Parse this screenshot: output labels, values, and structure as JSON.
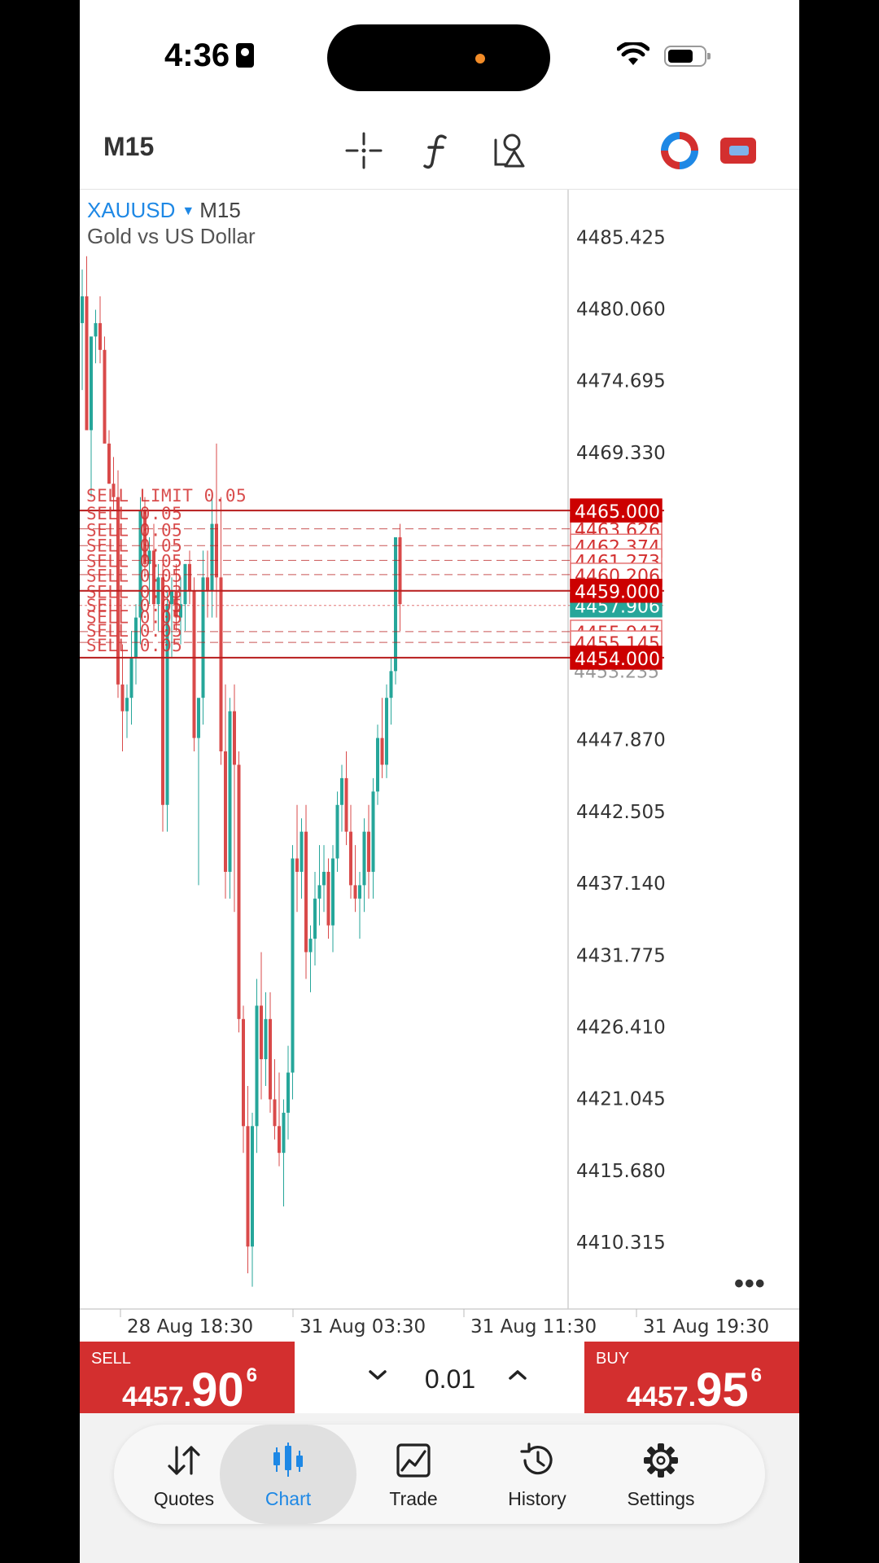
{
  "status_bar": {
    "time": "4:36"
  },
  "toolbar": {
    "timeframe": "M15",
    "icons": [
      "crosshair-icon",
      "function-icon",
      "objects-icon",
      "accounts-icon",
      "window-switch-icon"
    ]
  },
  "chart": {
    "symbol": "XAUUSD",
    "timeframe": "M15",
    "description": "Gold vs US Dollar",
    "price_axis_labels": [
      "4485.425",
      "4480.060",
      "4474.695",
      "4469.330",
      "4447.870",
      "4442.505",
      "4437.140",
      "4431.775",
      "4426.410",
      "4421.045",
      "4415.680",
      "4410.315"
    ],
    "time_axis_labels": [
      "28 Aug 18:30",
      "31 Aug 03:30",
      "31 Aug 11:30",
      "31 Aug 19:30"
    ],
    "order_labels": {
      "sell_limit": "SELL LIMIT 0.05",
      "sell_a": "SELL 0.05",
      "sell_b": "SELL 0.03"
    },
    "price_tags": {
      "tp_high": "4465.000",
      "p1": "4463.626",
      "p2": "4462.374",
      "p3": "4461.273",
      "p4": "4460.206",
      "p5": "4459.000",
      "bid": "4457.906",
      "p6": "4455.947",
      "p7": "4455.145",
      "sl_low": "4454.000",
      "hidden": "4453.235"
    },
    "colors": {
      "bull": "#26a69a",
      "bear": "#d94a4a",
      "order_line": "#b71c1c",
      "tag_bg": "#cc0000",
      "bid_tag": "#26a69a"
    }
  },
  "chart_data": {
    "type": "candlestick",
    "symbol": "XAUUSD",
    "timeframe": "M15",
    "ylim": [
      4407.6,
      4488.1
    ],
    "candles": [
      [
        4479,
        4483,
        4474,
        4481
      ],
      [
        4481,
        4484,
        4476,
        4471
      ],
      [
        4471,
        4476,
        4466,
        4478
      ],
      [
        4478,
        4480,
        4476,
        4479
      ],
      [
        4479,
        4481,
        4476,
        4477
      ],
      [
        4477,
        4478,
        4471,
        4470
      ],
      [
        4470,
        4471,
        4467,
        4467
      ],
      [
        4467,
        4469,
        4465,
        4466
      ],
      [
        4466,
        4468,
        4451,
        4452
      ],
      [
        4452,
        4455,
        4447,
        4450
      ],
      [
        4450,
        4452,
        4448,
        4451
      ],
      [
        4451,
        4456,
        4449,
        4454
      ],
      [
        4454,
        4458,
        4452,
        4457
      ],
      [
        4457,
        4466,
        4455,
        4465
      ],
      [
        4465,
        4466,
        4460,
        4461
      ],
      [
        4461,
        4463,
        4458,
        4462
      ],
      [
        4462,
        4464,
        4456,
        4458
      ],
      [
        4458,
        4461,
        4456,
        4460
      ],
      [
        4460,
        4461,
        4441,
        4443
      ],
      [
        4443,
        4459,
        4441,
        4458
      ],
      [
        4458,
        4460,
        4454,
        4459
      ],
      [
        4459,
        4461,
        4456,
        4457
      ],
      [
        4457,
        4460,
        4455,
        4458
      ],
      [
        4458,
        4461,
        4456,
        4461
      ],
      [
        4461,
        4462,
        4458,
        4459
      ],
      [
        4459,
        4460,
        4447,
        4448
      ],
      [
        4448,
        4450,
        4437,
        4451
      ],
      [
        4451,
        4462,
        4449,
        4460
      ],
      [
        4460,
        4462,
        4457,
        4459
      ],
      [
        4459,
        4466,
        4457,
        4464
      ],
      [
        4464,
        4470,
        4457,
        4460
      ],
      [
        4460,
        4466,
        4446,
        4447
      ],
      [
        4447,
        4452,
        4436,
        4438
      ],
      [
        4438,
        4451,
        4436,
        4450
      ],
      [
        4450,
        4452,
        4435,
        4446
      ],
      [
        4446,
        4447,
        4426,
        4427
      ],
      [
        4427,
        4428,
        4417,
        4419
      ],
      [
        4419,
        4422,
        4408,
        4410
      ],
      [
        4410,
        4420,
        4407,
        4419
      ],
      [
        4419,
        4430,
        4417,
        4428
      ],
      [
        4428,
        4432,
        4421,
        4424
      ],
      [
        4424,
        4429,
        4422,
        4427
      ],
      [
        4427,
        4429,
        4420,
        4421
      ],
      [
        4421,
        4424,
        4418,
        4419
      ],
      [
        4419,
        4423,
        4416,
        4417
      ],
      [
        4417,
        4421,
        4413,
        4420
      ],
      [
        4420,
        4425,
        4418,
        4423
      ],
      [
        4423,
        4440,
        4421,
        4439
      ],
      [
        4439,
        4443,
        4435,
        4438
      ],
      [
        4438,
        4442,
        4436,
        4441
      ],
      [
        4441,
        4443,
        4430,
        4432
      ],
      [
        4432,
        4434,
        4429,
        4433
      ],
      [
        4433,
        4438,
        4431,
        4436
      ],
      [
        4436,
        4440,
        4434,
        4437
      ],
      [
        4437,
        4440,
        4435,
        4438
      ],
      [
        4438,
        4439,
        4433,
        4434
      ],
      [
        4434,
        4440,
        4432,
        4439
      ],
      [
        4439,
        4444,
        4438,
        4443
      ],
      [
        4443,
        4446,
        4441,
        4445
      ],
      [
        4445,
        4447,
        4440,
        4441
      ],
      [
        4441,
        4443,
        4436,
        4437
      ],
      [
        4437,
        4440,
        4435,
        4436
      ],
      [
        4436,
        4438,
        4433,
        4437
      ],
      [
        4437,
        4442,
        4435,
        4441
      ],
      [
        4441,
        4443,
        4436,
        4438
      ],
      [
        4438,
        4445,
        4436,
        4444
      ],
      [
        4444,
        4449,
        4443,
        4448
      ],
      [
        4448,
        4451,
        4445,
        4446
      ],
      [
        4446,
        4452,
        4445,
        4451
      ],
      [
        4451,
        4454,
        4449,
        4453
      ],
      [
        4453,
        4463,
        4452,
        4463
      ],
      [
        4463,
        4464,
        4456,
        4458
      ]
    ],
    "horizontal_lines": [
      {
        "label": "SELL LIMIT 0.05",
        "price": 4465.0
      },
      {
        "price": 4463.626
      },
      {
        "price": 4462.374
      },
      {
        "price": 4461.273
      },
      {
        "price": 4460.206
      },
      {
        "price": 4459.0
      },
      {
        "price": 4457.906
      },
      {
        "price": 4455.947
      },
      {
        "price": 4455.145
      },
      {
        "price": 4454.0
      }
    ]
  },
  "trade_panel": {
    "sell": {
      "label": "SELL",
      "price_small": "4457.",
      "price_big": "90",
      "price_sup": "6"
    },
    "buy": {
      "label": "BUY",
      "price_small": "4457.",
      "price_big": "95",
      "price_sup": "6"
    },
    "lot": "0.01",
    "lot_down_symbol": "⌄",
    "lot_up_symbol": "⌃"
  },
  "nav": {
    "items": [
      {
        "label": "Quotes",
        "icon": "quotes-icon"
      },
      {
        "label": "Chart",
        "icon": "chart-icon",
        "active": true
      },
      {
        "label": "Trade",
        "icon": "trade-icon"
      },
      {
        "label": "History",
        "icon": "history-icon"
      },
      {
        "label": "Settings",
        "icon": "settings-icon"
      }
    ]
  }
}
